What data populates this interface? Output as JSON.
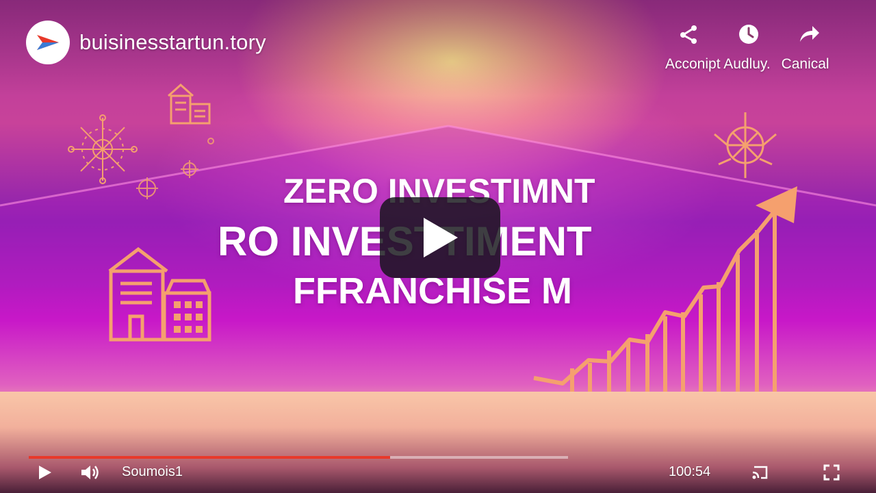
{
  "channel": {
    "name": "buisinesstartun.tory",
    "logo_icon": "arrow-logo-icon"
  },
  "top_actions": {
    "icons": [
      "share-icon",
      "clock-icon",
      "forward-arrow-icon"
    ],
    "labels": [
      "Acconipt Audluy.",
      "Canical"
    ]
  },
  "headline": {
    "line1": "ZERO INVESTIMNT",
    "line2": "RO INVESTTIMENT",
    "line3": "FFRANCHISE M"
  },
  "player": {
    "big_play_icon": "play-icon",
    "progress": 0.67,
    "volume_label": "Soumois1",
    "time": "100:54",
    "icons": [
      "play-icon",
      "volume-icon",
      "cast-icon",
      "fullscreen-icon"
    ]
  },
  "colors": {
    "progress_fill": "#e8392a",
    "accent_orange": "#f5a06e",
    "play_overlay": "#141418"
  }
}
